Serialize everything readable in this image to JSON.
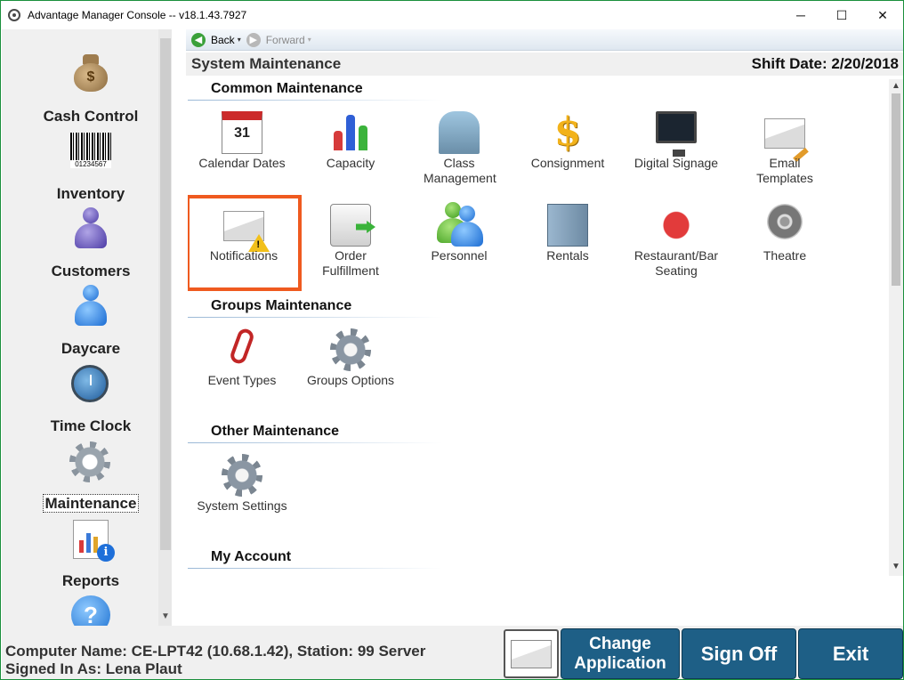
{
  "window": {
    "title": "Advantage Manager Console -- v18.1.43.7927",
    "minimize": "─",
    "maximize": "☐",
    "close": "✕"
  },
  "sidebar": {
    "items": [
      {
        "label": "Cash Control",
        "icon": "money-bag-icon"
      },
      {
        "label": "Inventory",
        "icon": "barcode-icon"
      },
      {
        "label": "Customers",
        "icon": "person-icon"
      },
      {
        "label": "Daycare",
        "icon": "person-icon"
      },
      {
        "label": "Time Clock",
        "icon": "clock-icon"
      },
      {
        "label": "Maintenance",
        "icon": "gear-icon",
        "selected": true
      },
      {
        "label": "Reports",
        "icon": "report-chart-icon"
      },
      {
        "label": "",
        "icon": "help-icon"
      }
    ],
    "money_symbol": "$",
    "barcode_number": "01234567",
    "info_glyph": "i",
    "help_glyph": "?"
  },
  "navbar": {
    "back_label": "Back",
    "forward_label": "Forward",
    "back_glyph": "◀",
    "forward_glyph": "▶",
    "dropdown_glyph": "▾"
  },
  "header": {
    "title": "System Maintenance",
    "shift_date": "Shift Date: 2/20/2018"
  },
  "sections": {
    "common": {
      "title": "Common Maintenance",
      "items": [
        {
          "label": "Calendar Dates",
          "icon": "calendar-icon"
        },
        {
          "label": "Capacity",
          "icon": "bar-chart-icon"
        },
        {
          "label": "Class Management",
          "icon": "building-icon"
        },
        {
          "label": "Consignment",
          "icon": "dollar-icon"
        },
        {
          "label": "Digital Signage",
          "icon": "monitor-icon"
        },
        {
          "label": "Email Templates",
          "icon": "email-edit-icon"
        },
        {
          "label": "Notifications",
          "icon": "notification-warning-icon",
          "highlighted": true
        },
        {
          "label": "Order Fulfillment",
          "icon": "delivery-truck-icon"
        },
        {
          "label": "Personnel",
          "icon": "people-icon"
        },
        {
          "label": "Rentals",
          "icon": "locker-icon"
        },
        {
          "label": "Restaurant/Bar Seating",
          "icon": "table-seating-icon"
        },
        {
          "label": "Theatre",
          "icon": "film-reel-icon"
        }
      ]
    },
    "groups": {
      "title": "Groups Maintenance",
      "items": [
        {
          "label": "Event Types",
          "icon": "paperclip-icon"
        },
        {
          "label": "Groups Options",
          "icon": "gear-edit-icon"
        }
      ]
    },
    "other": {
      "title": "Other Maintenance",
      "items": [
        {
          "label": "System Settings",
          "icon": "gear-icon"
        }
      ]
    },
    "account": {
      "title": "My Account"
    }
  },
  "calendar_day": "31",
  "status": {
    "computer_line": "Computer Name: CE-LPT42 (10.68.1.42), Station: 99 Server",
    "signed_in_line": "Signed In As: Lena Plaut"
  },
  "buttons": {
    "change_application_line1": "Change",
    "change_application_line2": "Application",
    "sign_off": "Sign Off",
    "exit": "Exit"
  },
  "colors": {
    "accent_button": "#1e5f86",
    "highlight_outline": "#ef5a1f",
    "window_border": "#1a8f3c"
  }
}
